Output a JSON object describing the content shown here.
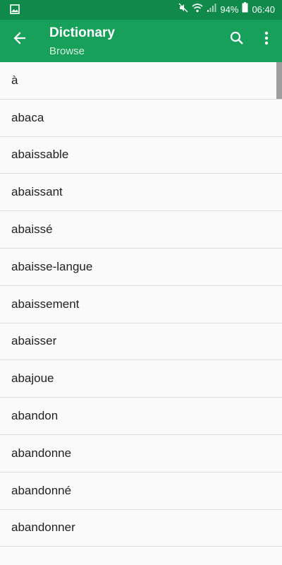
{
  "status_bar": {
    "battery_percent": "94%",
    "time": "06:40",
    "left_icon": "image-icon"
  },
  "app_bar": {
    "title": "Dictionary",
    "subtitle": "Browse",
    "back_icon": "back-arrow-icon",
    "search_icon": "search-icon",
    "more_icon": "more-vert-icon"
  },
  "colors": {
    "status_bar": "#0f8a4a",
    "app_bar": "#16a05a",
    "list_background": "#fafafa",
    "divider": "#dcdcdc"
  },
  "words": [
    {
      "text": "à"
    },
    {
      "text": "abaca"
    },
    {
      "text": "abaissable"
    },
    {
      "text": "abaissant"
    },
    {
      "text": "abaissé"
    },
    {
      "text": "abaisse-langue"
    },
    {
      "text": "abaissement"
    },
    {
      "text": "abaisser"
    },
    {
      "text": "abajoue"
    },
    {
      "text": "abandon"
    },
    {
      "text": "abandonne"
    },
    {
      "text": "abandonné"
    },
    {
      "text": "abandonner"
    },
    {
      "text": ""
    }
  ]
}
